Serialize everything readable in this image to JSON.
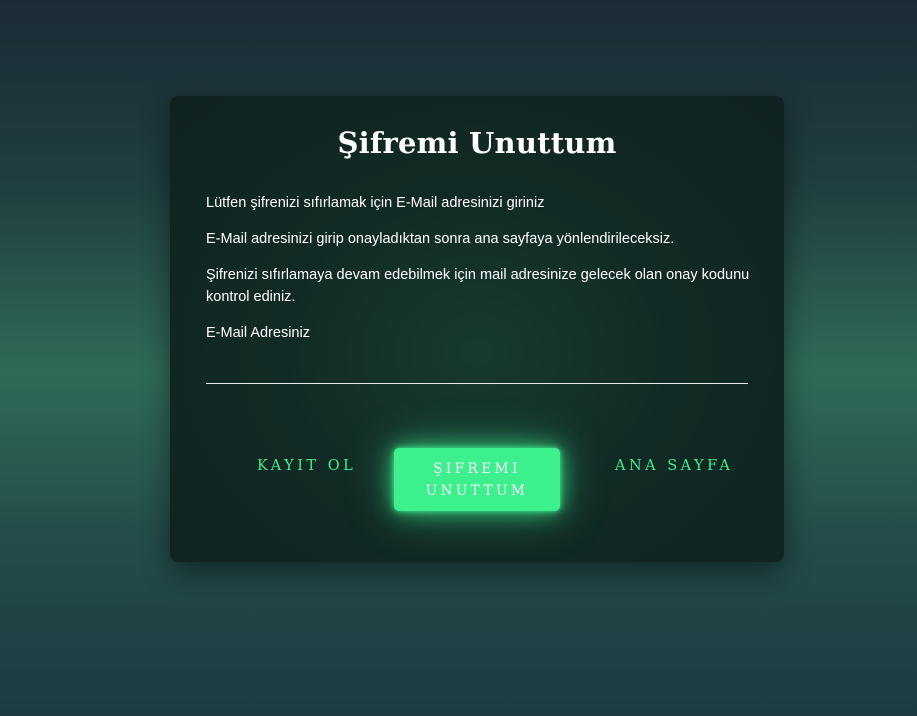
{
  "form": {
    "title": "Şifremi Unuttum",
    "instructions": [
      "Lütfen şifrenizi sıfırlamak için E-Mail adresinizi giriniz",
      "E-Mail adresinizi girip onayladıktan sonra ana sayfaya yönlendirileceksiz.",
      "Şifrenizi sıfırlamaya devam edebilmek için mail adresinize gelecek olan onay kodunu kontrol ediniz."
    ],
    "email_label": "E-Mail Adresiniz",
    "email_value": "",
    "email_placeholder": ""
  },
  "actions": {
    "register_label": "KAYIT OL",
    "reset_label": "ŞIFREMI UNUTTUM",
    "home_label": "ANA SAYFA"
  },
  "colors": {
    "accent": "#3cf08e",
    "card_background": "#122a25",
    "text": "#ffffff"
  }
}
